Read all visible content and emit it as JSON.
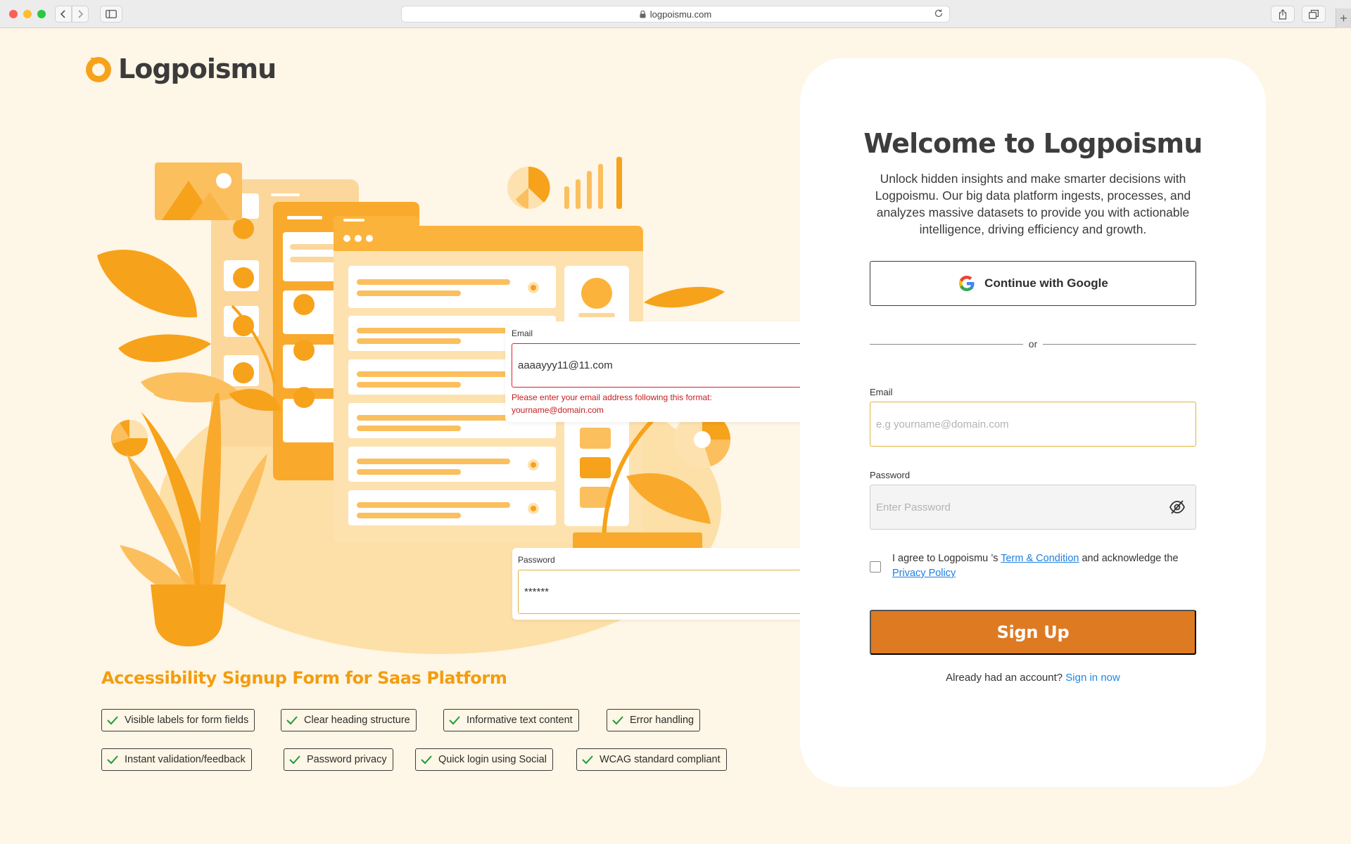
{
  "browser": {
    "url": "logpoismu.com"
  },
  "brand": {
    "name": "Logpoismu",
    "accent": "#f7a21b",
    "button_color": "#de7a22",
    "text_color": "#3d3d3d"
  },
  "illustration": {
    "email_label": "Email",
    "email_value": "aaaayyy11@11.com",
    "email_error": "Please enter your email address following this format: yourname@domain.com",
    "password_label": "Password",
    "password_value": "******"
  },
  "features": {
    "title": "Accessibility Signup Form for Saas Platform",
    "chips": [
      "Visible labels for form fields",
      "Clear heading structure",
      "Informative text content",
      "Error handling",
      "Instant validation/feedback",
      "Password privacy",
      "Quick login using Social",
      "WCAG standard compliant"
    ]
  },
  "signup": {
    "heading": "Welcome to Logpoismu",
    "description": "Unlock hidden insights and make smarter decisions with Logpoismu. Our big data platform ingests, processes, and analyzes massive datasets to provide you with actionable intelligence, driving efficiency and growth.",
    "google_label": "Continue with Google",
    "or_label": "or",
    "email_label": "Email",
    "email_placeholder": "e.g yourname@domain.com",
    "password_label": "Password",
    "password_placeholder": "Enter Password",
    "agree_prefix": "I agree to Logpoismu ’s ",
    "terms_link": "Term & Condition",
    "agree_middle": " and acknowledge the ",
    "privacy_link": "Privacy Policy",
    "button_label": "Sign Up",
    "signin_prompt": "Already had an account?",
    "signin_link": "Sign in now"
  }
}
